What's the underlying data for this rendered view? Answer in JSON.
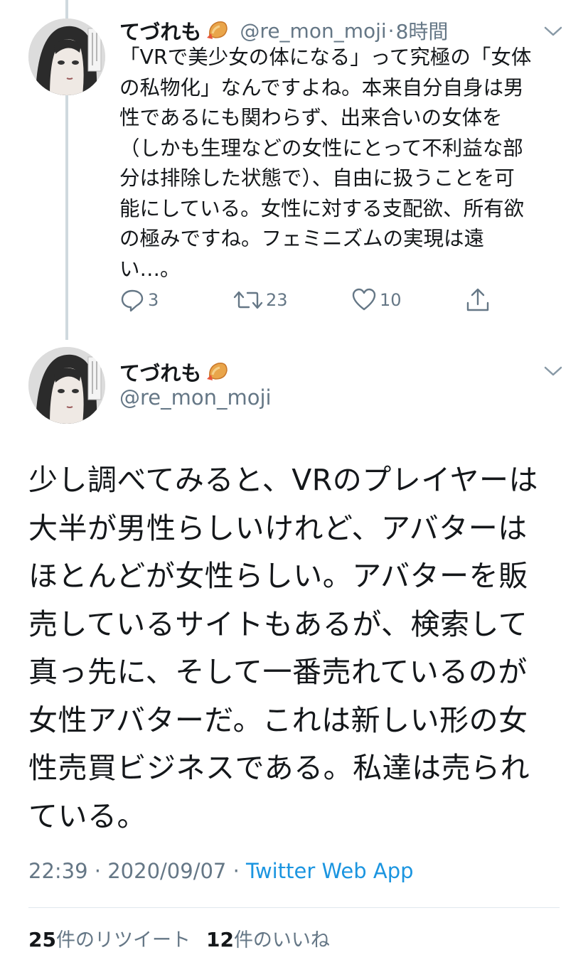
{
  "reply_tweet": {
    "display_name": "てづれも",
    "handle": "@re_mon_moji",
    "separator": "·",
    "time": "8時間",
    "text": "「VRで美少女の体になる」って究極の「女体\nの私物化」なんですよね。本来自分自身は男\n性であるにも関わらず、出来合いの女体を\n（しかも生理などの女性にとって不利益な部\n分は排除した状態で）、自由に扱うことを可\n能にしている。女性に対する支配欲、所有欲\nの極みですね。フェミニズムの実現は遠\nい…。",
    "reply_count": "3",
    "retweet_count": "23",
    "like_count": "10"
  },
  "main_tweet": {
    "display_name": "てづれも",
    "handle": "@re_mon_moji",
    "text": "少し調べてみると、VRのプレイヤーは\n大半が男性らしいけれど、アバターは\nほとんどが女性らしい。アバターを販\n売しているサイトもあるが、検索して\n真っ先に、そして一番売れているのが\n女性アバターだ。これは新しい形の女\n性売買ビジネスである。私達は売られ\nている。",
    "time": "22:39",
    "meta_separator": "·",
    "date": "2020/09/07",
    "source": "Twitter Web App",
    "retweets_num": "25",
    "retweets_label": "件のリツイート",
    "likes_num": "12",
    "likes_label": "件のいいね"
  },
  "icons": {
    "emoji": "shrimp-tempura-icon",
    "menu": "chevron-down-icon",
    "reply": "reply-icon",
    "retweet": "retweet-icon",
    "like": "heart-icon",
    "share": "share-icon"
  },
  "colors": {
    "text": "#14171a",
    "secondary": "#657786",
    "link": "#1b95e0",
    "thread_line": "#cfd9de"
  }
}
